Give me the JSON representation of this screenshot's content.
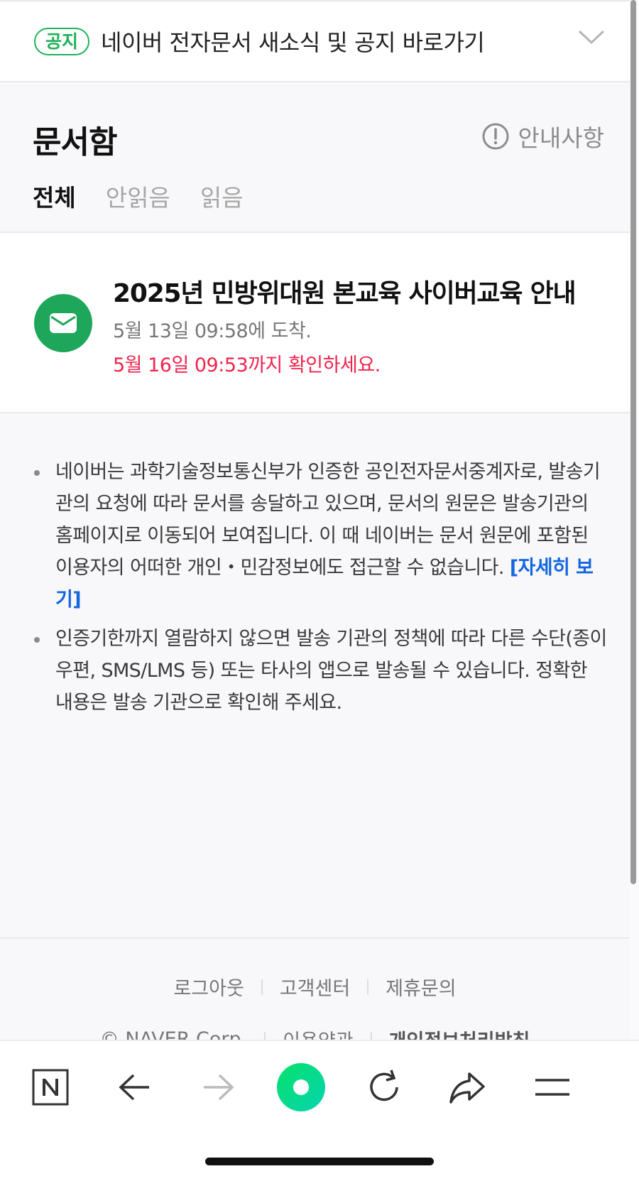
{
  "notice": {
    "badge": "공지",
    "text": "네이버 전자문서 새소식 및 공지 바로가기"
  },
  "header": {
    "title": "문서함",
    "guide_label": "안내사항",
    "tabs": [
      {
        "label": "전체",
        "active": true
      },
      {
        "label": "안읽음",
        "active": false
      },
      {
        "label": "읽음",
        "active": false
      }
    ]
  },
  "document": {
    "title": "2025년 민방위대원 본교육 사이버교육 안내",
    "arrived": "5월 13일 09:58에 도착.",
    "deadline": "5월 16일 09:53까지 확인하세요.",
    "icon": "envelope-icon",
    "accent_color": "#1ea65a",
    "deadline_color": "#f2234e"
  },
  "info": {
    "item1_text": "네이버는 과학기술정보통신부가 인증한 공인전자문서중계자로, 발송기관의 요청에 따라 문서를 송달하고 있으며, 문서의 원문은 발송기관의 홈페이지로 이동되어 보여집니다. 이 때 네이버는 문서 원문에 포함된 이용자의 어떠한 개인・민감정보에도 접근할 수 없습니다.",
    "item1_link": "[자세히 보기]",
    "item2_text": "인증기한까지 열람하지 않으면 발송 기관의 정책에 따라 다른 수단(종이 우편, SMS/LMS 등) 또는 타사의 앱으로 발송될 수 있습니다. 정확한 내용은 발송 기관으로 확인해 주세요."
  },
  "footer": {
    "row1": [
      "로그아웃",
      "고객센터",
      "제휴문의"
    ],
    "row2": [
      "© NAVER Corp.",
      "이용약관",
      "개인정보처리방침"
    ]
  },
  "browser_bar": {
    "icons": [
      "naver-n-icon",
      "back-arrow-icon",
      "forward-arrow-icon",
      "green-dot-icon",
      "reload-icon",
      "share-icon",
      "menu-icon"
    ]
  }
}
